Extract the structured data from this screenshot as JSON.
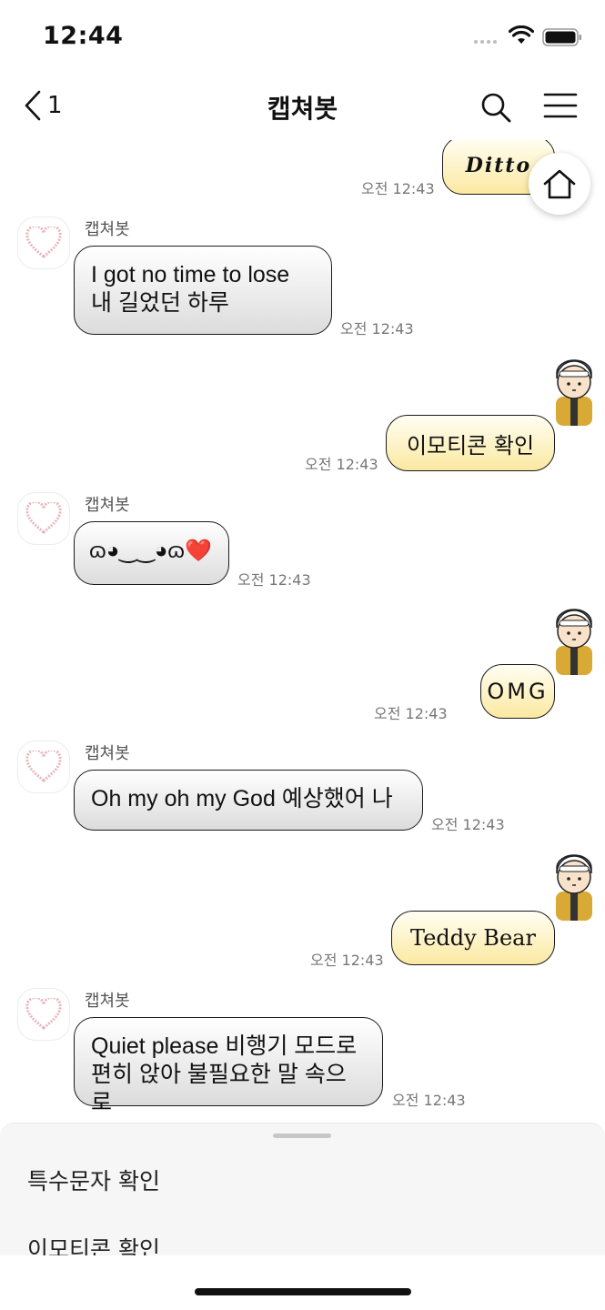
{
  "status_bar": {
    "time": "12:44"
  },
  "header": {
    "back_count": "1",
    "title": "캡쳐봇"
  },
  "messages": [
    {
      "type": "out-sticker",
      "text": "Ditto",
      "time": "오전 12:43"
    },
    {
      "type": "in",
      "sender": "캡쳐봇",
      "text": "I got no time to lose\n내 길었던 하루",
      "time": "오전 12:43"
    },
    {
      "type": "out",
      "text": "이모티콘 확인",
      "time": "오전 12:43"
    },
    {
      "type": "in",
      "sender": "캡쳐봇",
      "text": "ɷ◕‿‿◕ɷ❤️",
      "time": "오전 12:43"
    },
    {
      "type": "out",
      "text": "OMG",
      "time": "오전 12:43"
    },
    {
      "type": "in",
      "sender": "캡쳐봇",
      "text": "Oh my oh my God 예상했어 나",
      "time": "오전 12:43"
    },
    {
      "type": "out",
      "text": "Teddy Bear",
      "time": "오전 12:43"
    },
    {
      "type": "in",
      "sender": "캡쳐봇",
      "text": "Quiet please 비행기 모드로\n편히 앉아 불필요한 말 속으로",
      "time": "오전 12:43"
    }
  ],
  "quick_replies": [
    "특수문자 확인",
    "이모티콘 확인"
  ],
  "colors": {
    "incoming_bubble": "#e6e6e6",
    "outgoing_bubble": "#fbe9a1",
    "outline": "#1a1a1a"
  }
}
